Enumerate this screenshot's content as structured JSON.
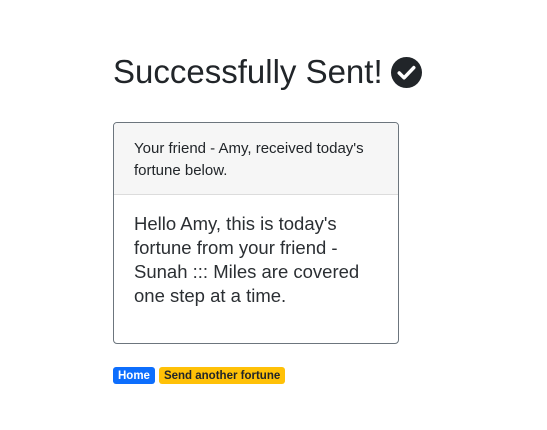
{
  "page": {
    "title": "Successfully Sent!",
    "title_icon": "check-circle-icon"
  },
  "card": {
    "header": "Your friend - Amy, received today's fortune below.",
    "body": "Hello Amy, this is today's fortune from your friend - Sunah ::: Miles are covered one step at a time."
  },
  "actions": {
    "home_label": "Home",
    "send_label": "Send another fortune"
  },
  "colors": {
    "home_badge": "#0d6efd",
    "send_badge": "#ffc107",
    "text": "#212529"
  }
}
